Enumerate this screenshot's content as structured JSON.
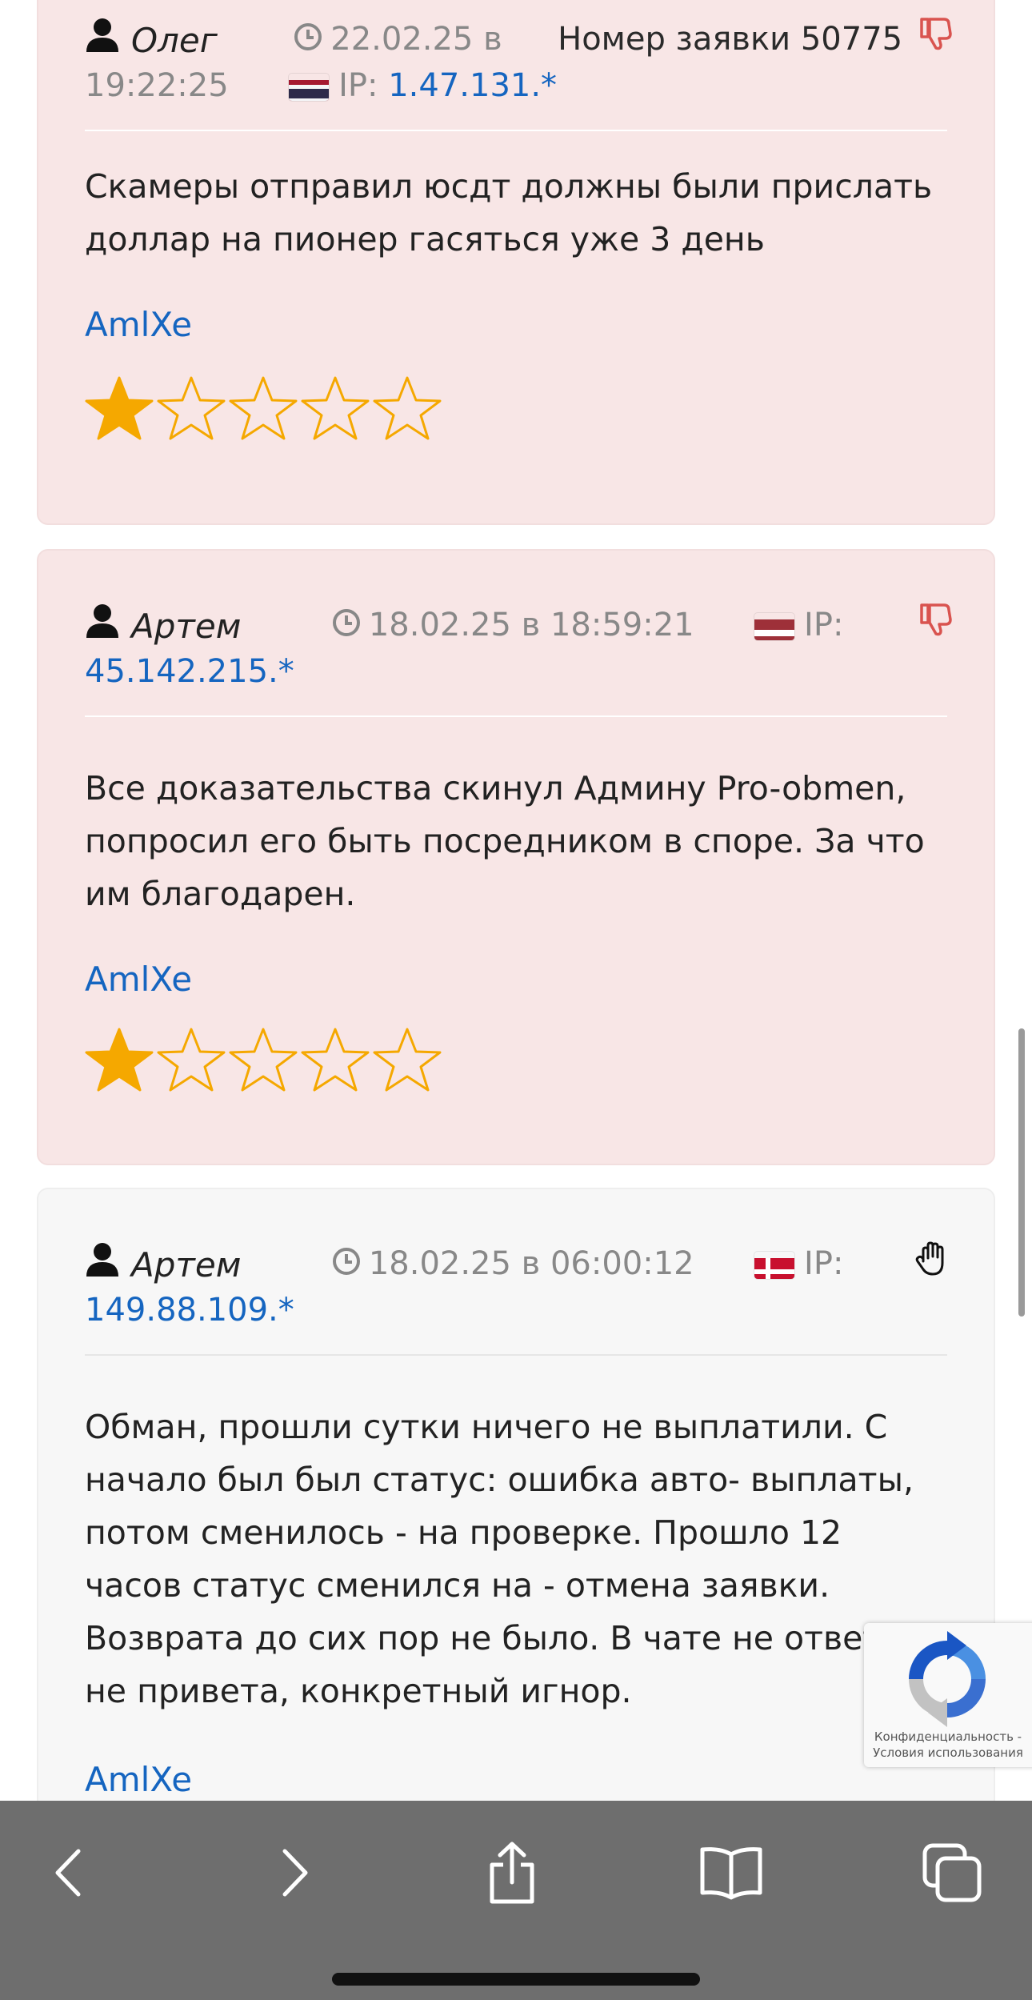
{
  "reviews": [
    {
      "author": "Олег",
      "date_line1": "22.02.25 в",
      "date_line2": "19:22:25",
      "order": "Номер заявки 50775",
      "ip_label": "IP:",
      "ip": "1.47.131.*",
      "flag": "thailand",
      "type": "negative",
      "text": "Скамеры отправил юсдт должны были прислать доллар на пионер гасяться уже 3 день",
      "exchanger": "AmlXe",
      "rating": 1,
      "rating_max": 5
    },
    {
      "author": "Артем",
      "date": "18.02.25 в 18:59:21",
      "ip_label": "IP:",
      "ip": "45.142.215.*",
      "flag": "latvia",
      "type": "negative",
      "text": "Все доказательства скинул Админу Pro-obmen, попросил его быть посредником в споре. За что им благодарен.",
      "exchanger": "AmlXe",
      "rating": 1,
      "rating_max": 5
    },
    {
      "author": "Артем",
      "date": "18.02.25 в 06:00:12",
      "ip_label": "IP:",
      "ip": "149.88.109.*",
      "flag": "denmark",
      "type": "neutral",
      "text": "Обман, прошли сутки ничего не выплатили. С начало был был статус: ошибка авто- выплаты, потом сменилось - на проверке. Прошло 12 часов статус сменился на - отмена заявки. Возврата до сих пор не было. В чате не ответа, не привета, конкретный игнор.",
      "exchanger": "AmlXe"
    }
  ],
  "recaptcha": {
    "privacy": "Конфиденциальность -",
    "terms": "Условия использования"
  },
  "toolbar": {
    "items": [
      "back-icon",
      "forward-icon",
      "share-icon",
      "bookmarks-icon",
      "tabs-icon"
    ]
  },
  "colors": {
    "negative_bg": "#f8e6e6",
    "neutral_bg": "#f7f7f7",
    "link": "#1565c0",
    "star": "#f5a800",
    "thumb_down": "#d9534f"
  },
  "scroll_position": 0.56
}
